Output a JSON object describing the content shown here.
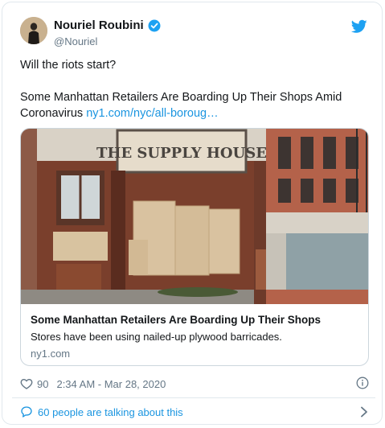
{
  "user": {
    "display_name": "Nouriel Roubini",
    "handle": "@Nouriel"
  },
  "icons": {
    "avatar": "avatar-photo",
    "verified": "verified-badge-icon",
    "brand": "twitter-bird-icon",
    "like": "heart-icon",
    "info": "info-icon",
    "reply": "speech-bubble-icon",
    "more": "chevron-right-icon"
  },
  "colors": {
    "accent": "#1b95e0",
    "secondary_text": "#657786",
    "border": "#e1e8ed"
  },
  "tweet": {
    "line1": "Will the riots start?",
    "line2": "Some Manhattan Retailers Are Boarding Up Their Shops Amid Coronavirus",
    "link_text": "ny1.com/nyc/all-boroug…"
  },
  "link_card": {
    "sign_text": "THE SUPPLY HOUSE",
    "title": "Some Manhattan Retailers Are Boarding Up Their Shops",
    "description": "Stores have been using nailed-up plywood barricades.",
    "domain": "ny1.com"
  },
  "meta": {
    "likes": "90",
    "timestamp": "2:34 AM - Mar 28, 2020"
  },
  "footer": {
    "talking": "60 people are talking about this"
  }
}
